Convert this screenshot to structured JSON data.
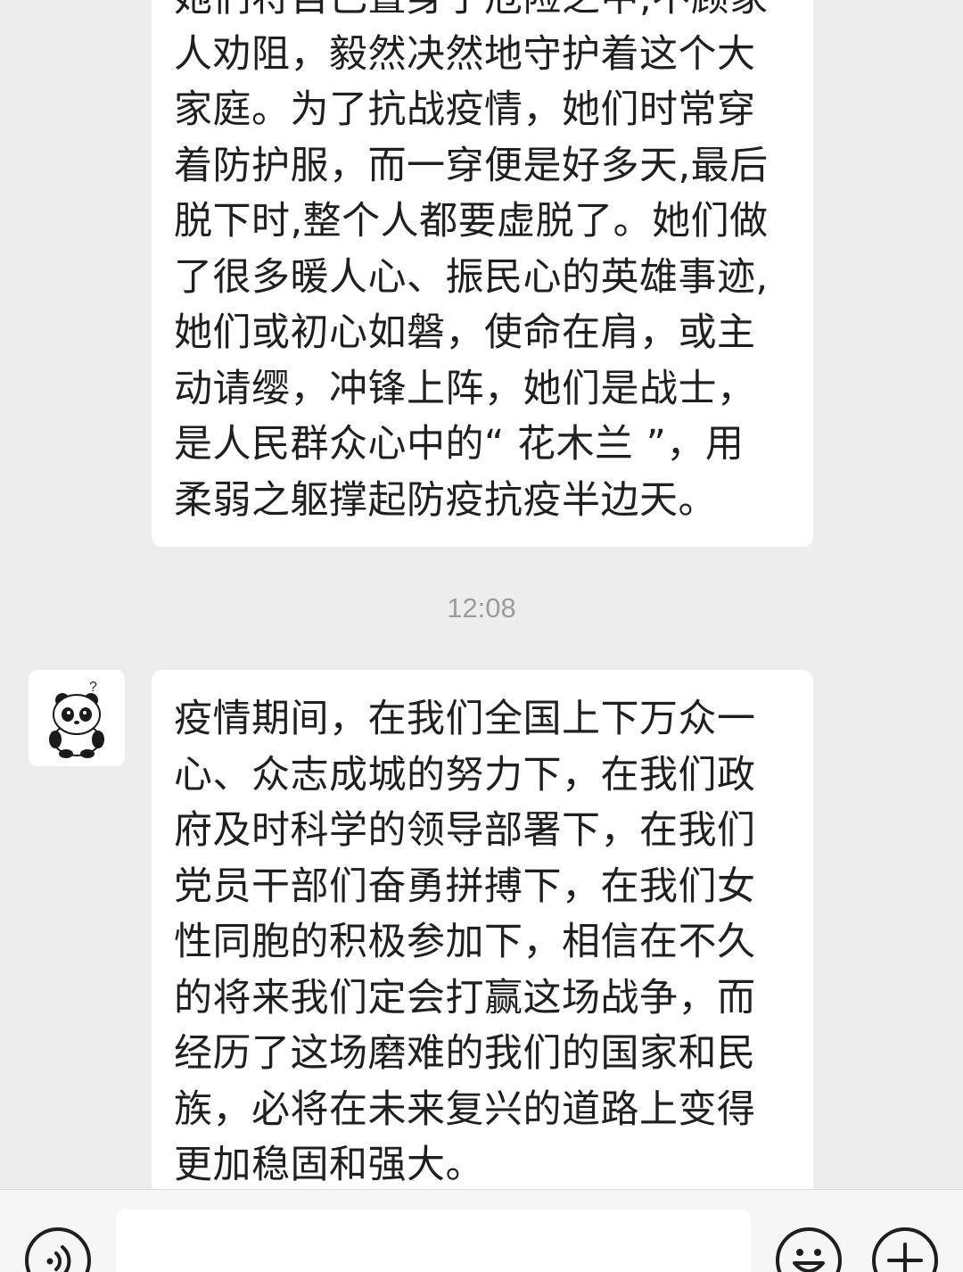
{
  "messages": [
    {
      "lines": [
        "她们将自己置身于危险之中,不顾家",
        "人劝阻，毅然决然地守护着这个大",
        "家庭。为了抗战疫情，她们时常穿",
        "着防护服，而一穿便是好多天,最后",
        "脱下时,整个人都要虚脱了。她们做",
        "了很多暖人心、振民心的英雄事迹,",
        "她们或初心如磐，使命在肩，或主",
        "动请缨，冲锋上阵，她们是战士，",
        "是人民群众心中的“ 花木兰 ”，用",
        "柔弱之躯撑起防疫抗疫半边天。"
      ]
    },
    {
      "lines": [
        "疫情期间，在我们全国上下万众一",
        "心、众志成城的努力下，在我们政",
        "府及时科学的领导部署下，在我们",
        "党员干部们奋勇拼搏下，在我们女",
        "性同胞的积极参加下，相信在不久",
        "的将来我们定会打赢这场战争，而",
        "经历了这场磨难的我们的国家和民",
        "族，必将在未来复兴的道路上变得",
        "更加稳固和强大。"
      ]
    }
  ],
  "timestamp": "12:08",
  "avatar": {
    "icon": "panda-avatar-icon",
    "badge": "?"
  },
  "input_bar": {
    "voice_icon": "voice-icon",
    "text_value": "",
    "emoji_icon": "emoji-icon",
    "add_icon": "plus-icon"
  },
  "colors": {
    "background": "#ededed",
    "bubble": "#ffffff",
    "text": "#1f1f1f",
    "timestamp": "#9c9c9c"
  }
}
